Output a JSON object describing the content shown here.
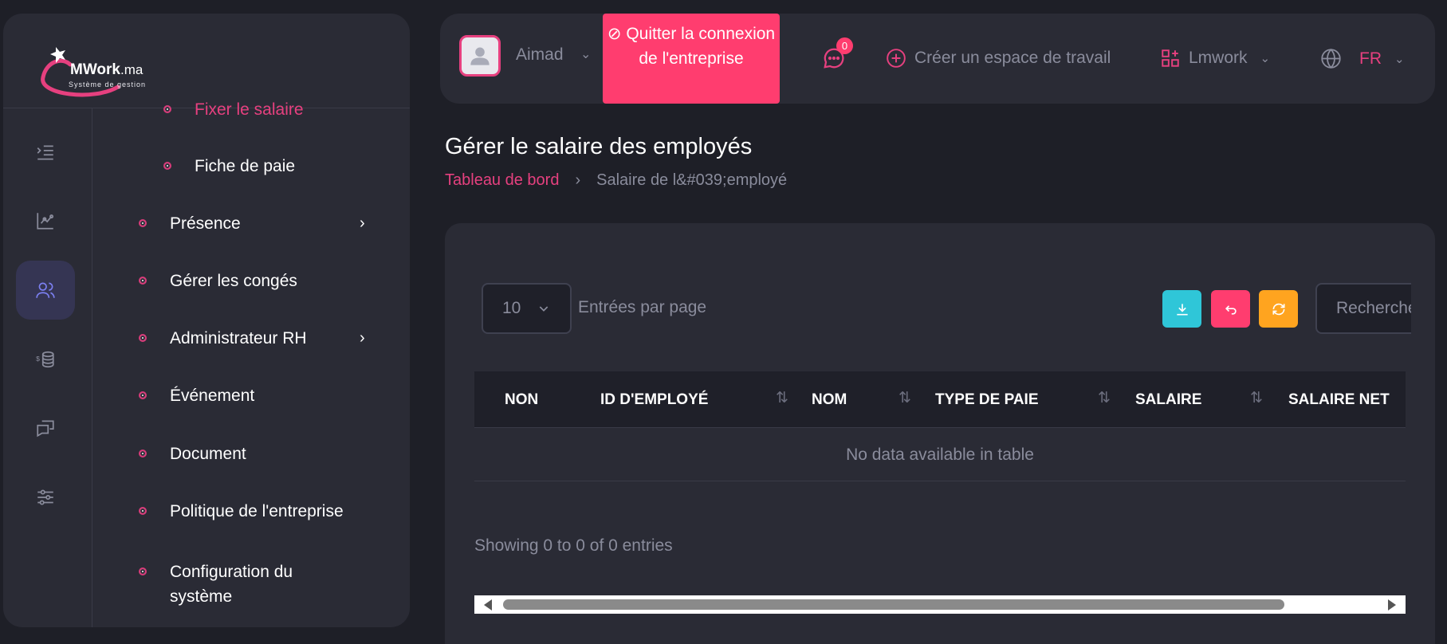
{
  "logo": {
    "brand": "MWork",
    "suffix": ".ma",
    "subtitle": "Système de gestion"
  },
  "colors": {
    "accent": "#e6407f",
    "quit_button": "#ff3d6f",
    "active_rail": "#353553"
  },
  "rail": [
    {
      "icon": "menu-collapse-icon"
    },
    {
      "icon": "chart-icon"
    },
    {
      "icon": "users-icon",
      "active": true
    },
    {
      "icon": "coins-icon"
    },
    {
      "icon": "messages-icon"
    },
    {
      "icon": "settings-sliders-icon"
    }
  ],
  "menu": {
    "sub_items": [
      "Fixer le salaire",
      "Fiche de paie"
    ],
    "items": [
      {
        "label": "Présence",
        "has_children": true
      },
      {
        "label": "Gérer les congés"
      },
      {
        "label": "Administrateur RH",
        "has_children": true
      },
      {
        "label": "Événement"
      },
      {
        "label": "Document"
      },
      {
        "label": "Politique de l'entreprise"
      },
      {
        "label": "Configuration du système"
      }
    ]
  },
  "topbar": {
    "user_name": "Aimad",
    "quit_label": "Quitter la connexion de l'entreprise",
    "messages_count": "0",
    "create_workspace": "Créer un espace de travail",
    "workspace": "Lmwork",
    "language": "FR"
  },
  "page": {
    "title": "Gérer le salaire des employés",
    "breadcrumb_home": "Tableau de bord",
    "breadcrumb_current": "Salaire de l&#039;employé"
  },
  "table": {
    "page_size": "10",
    "per_page_label": "Entrées par page",
    "search_placeholder": "Rechercher",
    "columns": [
      "NON",
      "ID D'EMPLOYÉ",
      "NOM",
      "TYPE DE PAIE",
      "SALAIRE",
      "SALAIRE NET"
    ],
    "empty_message": "No data available in table",
    "showing": "Showing 0 to 0 of 0 entries"
  }
}
